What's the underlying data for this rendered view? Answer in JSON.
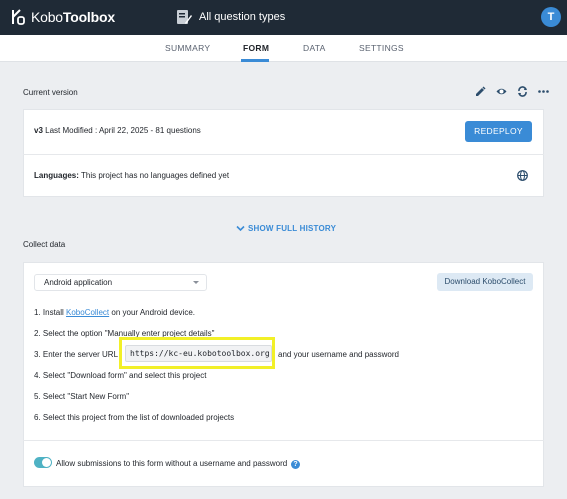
{
  "brand": {
    "name_light": "Kobo",
    "name_bold": "Toolbox"
  },
  "project": {
    "title": "All question types"
  },
  "user": {
    "initial": "T"
  },
  "tabs": [
    {
      "label": "SUMMARY"
    },
    {
      "label": "FORM"
    },
    {
      "label": "DATA"
    },
    {
      "label": "SETTINGS"
    }
  ],
  "current_version": {
    "heading": "Current version",
    "version": "v3",
    "modified": "Last Modified : April 22, 2025 - 81 questions",
    "redeploy_label": "REDEPLOY",
    "languages_label": "Languages:",
    "languages_text": "This project has no languages defined yet"
  },
  "history_label": "SHOW FULL HISTORY",
  "collect": {
    "heading": "Collect data",
    "selected_method": "Android application",
    "download_label": "Download KoboCollect",
    "steps": {
      "s1_prefix": "1.  Install ",
      "s1_link": "KoboCollect",
      "s1_suffix": " on your Android device.",
      "s2": "2.  Select the option \"Manually enter project details\"",
      "s3_prefix": "3.  Enter the server URL",
      "s3_url": "https://kc-eu.kobotoolbox.org",
      "s3_suffix": "and your username and password",
      "s4": "4.  Select \"Download form\" and select this project",
      "s5": "5.  Select \"Start New Form\"",
      "s6": "6.  Select this project from the list of downloaded projects"
    },
    "toggle_label": "Allow submissions to this form without a username and password",
    "help_glyph": "?"
  },
  "colors": {
    "header": "#1f2a36",
    "accent": "#3a8bd6",
    "highlight": "#f2f028",
    "toggle": "#4fb2c4"
  }
}
